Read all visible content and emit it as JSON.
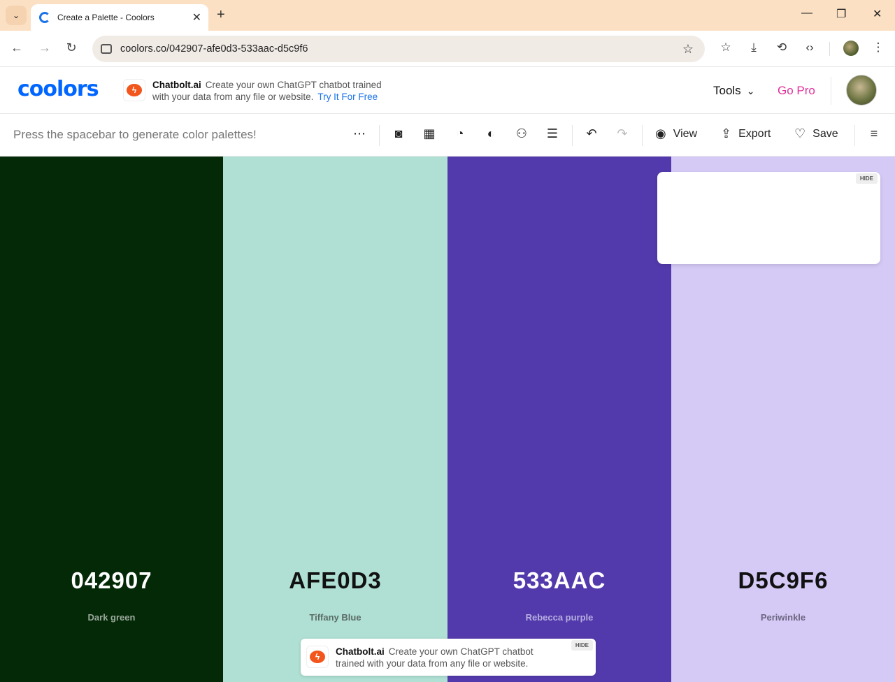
{
  "browser": {
    "tab_title": "Create a Palette - Coolors",
    "url": "coolors.co/042907-afe0d3-533aac-d5c9f6"
  },
  "header": {
    "logo": "coolors",
    "ad": {
      "brand": "Chatbolt.ai",
      "line1": "Create your own ChatGPT chatbot trained",
      "line2": "with your data from any file or website.",
      "link": "Try It For Free"
    },
    "tools_label": "Tools",
    "gopro_label": "Go Pro"
  },
  "toolbar": {
    "hint": "Press the spacebar to generate color palettes!",
    "view_label": "View",
    "export_label": "Export",
    "save_label": "Save"
  },
  "palette": [
    {
      "hex": "042907",
      "name": "Dark green",
      "bg": "#042907",
      "fg": "#ffffff",
      "sub": "#9aa89b"
    },
    {
      "hex": "AFE0D3",
      "name": "Tiffany Blue",
      "bg": "#afe0d3",
      "fg": "#111111",
      "sub": "#5b6b66"
    },
    {
      "hex": "533AAC",
      "name": "Rebecca purple",
      "bg": "#533aac",
      "fg": "#ffffff",
      "sub": "#b6aee0"
    },
    {
      "hex": "D5C9F6",
      "name": "Periwinkle",
      "bg": "#d5c9f6",
      "fg": "#111111",
      "sub": "#6c6680"
    }
  ],
  "side_ad": {
    "hide_label": "HIDE"
  },
  "bottom_ad": {
    "brand": "Chatbolt.ai",
    "line1": "Create your own ChatGPT chatbot",
    "line2": "trained with your data from any file or website.",
    "hide_label": "HIDE"
  }
}
